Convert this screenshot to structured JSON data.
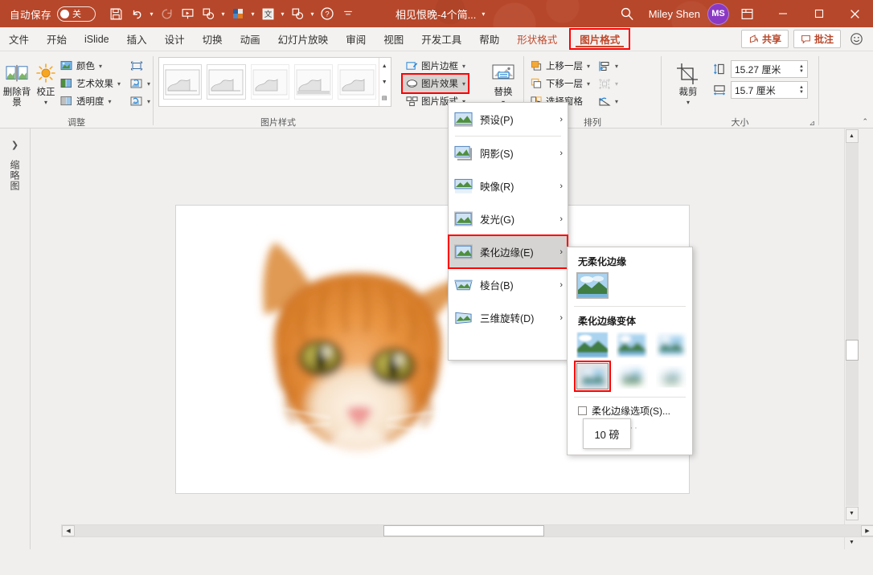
{
  "titlebar": {
    "autosave_label": "自动保存",
    "autosave_state": "关",
    "document_title": "相见恨晚-4个简...",
    "username": "Miley Shen",
    "avatar_initials": "MS",
    "qat_icons": [
      "save-icon",
      "undo-icon",
      "redo-icon",
      "start-slideshow-icon",
      "shape-icon",
      "color-swatch-icon",
      "islide-icon",
      "shape2-icon",
      "help-icon",
      "more-icon"
    ],
    "window_buttons": [
      "minimize",
      "maximize",
      "close"
    ],
    "search_icon": "search-icon",
    "ribbon_display_icon": "ribbon-display-options-icon"
  },
  "tabs": [
    {
      "label": "文件",
      "style": "normal"
    },
    {
      "label": "开始",
      "style": "normal"
    },
    {
      "label": "iSlide",
      "style": "normal"
    },
    {
      "label": "插入",
      "style": "normal"
    },
    {
      "label": "设计",
      "style": "normal"
    },
    {
      "label": "切换",
      "style": "normal"
    },
    {
      "label": "动画",
      "style": "normal"
    },
    {
      "label": "幻灯片放映",
      "style": "normal"
    },
    {
      "label": "审阅",
      "style": "normal"
    },
    {
      "label": "视图",
      "style": "normal"
    },
    {
      "label": "开发工具",
      "style": "normal"
    },
    {
      "label": "帮助",
      "style": "normal"
    },
    {
      "label": "形状格式",
      "style": "accent"
    },
    {
      "label": "图片格式",
      "style": "active-boxed"
    }
  ],
  "tab_right": {
    "share_label": "共享",
    "comments_label": "批注",
    "smiley_icon": "smiley-icon"
  },
  "ribbon": {
    "groups": [
      {
        "name": "调整",
        "remove_bg_label": "删除背景",
        "correction_label": "校正",
        "items": [
          {
            "label": "颜色",
            "icon": "picture-color-icon"
          },
          {
            "label": "艺术效果",
            "icon": "artistic-effects-icon"
          },
          {
            "label": "透明度",
            "icon": "transparency-icon"
          }
        ],
        "extra_icons": [
          "compress-pictures-icon",
          "change-picture-icon",
          "reset-picture-icon"
        ]
      },
      {
        "name": "图片样式",
        "thumb_count": 5,
        "side_items": [
          {
            "label": "图片边框",
            "icon": "picture-border-icon"
          },
          {
            "label": "图片效果",
            "icon": "picture-effects-icon",
            "highlighted": true
          },
          {
            "label": "图片版式",
            "icon": "picture-layout-icon"
          }
        ],
        "replace_label": "替换"
      },
      {
        "name": "排列",
        "items": [
          {
            "label": "上移一层",
            "icon": "bring-forward-icon"
          },
          {
            "label": "下移一层",
            "icon": "send-backward-icon"
          },
          {
            "label": "选择窗格",
            "icon": "selection-pane-icon"
          }
        ],
        "align_icons": [
          "align-objects-icon",
          "group-objects-icon",
          "rotate-objects-icon"
        ]
      },
      {
        "name": "大小",
        "crop_label": "裁剪",
        "height_value": "15.27 厘米",
        "width_value": "15.7 厘米",
        "height_icon": "shape-height-icon",
        "width_icon": "shape-width-icon",
        "dialog_launcher_icon": "dialog-launcher-icon"
      }
    ]
  },
  "effects_menu": {
    "items": [
      {
        "label": "预设(P)",
        "icon": "preset-effect-icon",
        "selected": false
      },
      {
        "label": "阴影(S)",
        "icon": "shadow-effect-icon",
        "selected": false
      },
      {
        "label": "映像(R)",
        "icon": "reflection-effect-icon",
        "selected": false
      },
      {
        "label": "发光(G)",
        "icon": "glow-effect-icon",
        "selected": false
      },
      {
        "label": "柔化边缘(E)",
        "icon": "soft-edges-effect-icon",
        "selected": true
      },
      {
        "label": "棱台(B)",
        "icon": "bevel-effect-icon",
        "selected": false
      },
      {
        "label": "三维旋转(D)",
        "icon": "3d-rotation-effect-icon",
        "selected": false
      }
    ],
    "arrow_glyph": "›"
  },
  "soft_edges_submenu": {
    "no_soft_edges_header": "无柔化边缘",
    "variations_header": "柔化边缘变体",
    "options_label": "柔化边缘选项(S)...",
    "tooltip": "10 磅",
    "variation_count": 6,
    "selected_variation_index": 3
  },
  "workspace": {
    "thumbnail_pane_label": "缩略图",
    "expand_icon": "chevron-right-icon",
    "slide_image_alt": "orange-tabby-cat-face"
  },
  "colors": {
    "brand": "#b7472a",
    "accent_text": "#c0492b",
    "highlight_red": "#ff0000",
    "avatar": "#8a39c4",
    "ribbon_bg": "#f3f2f1",
    "workspace_bg": "#f0efee"
  }
}
